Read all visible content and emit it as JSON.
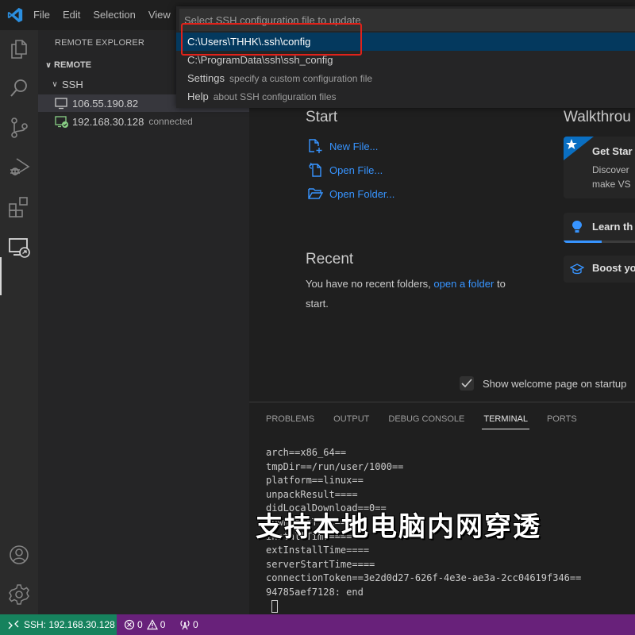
{
  "titlebar": {
    "menu": [
      "File",
      "Edit",
      "Selection",
      "View"
    ]
  },
  "activity_bar": {
    "icons": [
      "explorer-icon",
      "search-icon",
      "source-control-icon",
      "run-debug-icon",
      "extensions-icon",
      "remote-explorer-icon",
      "accounts-icon",
      "settings-gear-icon"
    ],
    "active": "remote-explorer-icon"
  },
  "sidebar": {
    "title": "REMOTE EXPLORER",
    "section": "REMOTE",
    "group": "SSH",
    "hosts": [
      {
        "name": "106.55.190.82",
        "status": "",
        "icon": "monitor-icon"
      },
      {
        "name": "192.168.30.128",
        "status": "connected",
        "icon": "monitor-connected-icon"
      }
    ]
  },
  "quick_pick": {
    "placeholder": "Select SSH configuration file to update",
    "items": [
      {
        "label": "C:\\Users\\THHK\\.ssh\\config",
        "description": "",
        "selected": true
      },
      {
        "label": "C:\\ProgramData\\ssh\\ssh_config",
        "description": ""
      },
      {
        "label": "Settings",
        "description": "specify a custom configuration file"
      },
      {
        "label": "Help",
        "description": "about SSH configuration files"
      }
    ],
    "highlight_color": "#e0221a"
  },
  "welcome": {
    "start_heading": "Start",
    "start_links": [
      {
        "label": "New File...",
        "icon": "new-file-icon"
      },
      {
        "label": "Open File...",
        "icon": "open-file-icon"
      },
      {
        "label": "Open Folder...",
        "icon": "open-folder-icon"
      }
    ],
    "recent_heading": "Recent",
    "recent_text_before": "You have no recent folders,",
    "recent_link": "open a folder",
    "recent_text_after": "to start.",
    "walkthroughs_heading": "Walkthrou",
    "walkthroughs": [
      {
        "title": "Get Star",
        "description": [
          "Discover",
          "make VS"
        ],
        "icon": "star-icon"
      },
      {
        "title": "Learn th",
        "icon": "lightbulb-icon",
        "progress": 0.4
      },
      {
        "title": "Boost yo",
        "icon": "mortarboard-icon"
      }
    ],
    "show_on_startup_label": "Show welcome page on startup",
    "show_on_startup_checked": true
  },
  "panel": {
    "tabs": [
      "PROBLEMS",
      "OUTPUT",
      "DEBUG CONSOLE",
      "TERMINAL",
      "PORTS"
    ],
    "active_tab": "TERMINAL",
    "terminal_lines": [
      "arch==x86_64==",
      "tmpDir==/run/user/1000==",
      "platform==linux==",
      "unpackResult====",
      "didLocalDownload==0==",
      "downloadTime====",
      "installTime====",
      "extInstallTime====",
      "serverStartTime====",
      "connectionToken==3e2d0d27-626f-4e3e-ae3a-2cc04619f346==",
      "94785aef7128: end"
    ]
  },
  "overlay_caption": "支持本地电脑内网穿透",
  "status_bar": {
    "remote": "SSH: 192.168.30.128",
    "errors": "0",
    "warnings": "0",
    "ports": "0",
    "remote_color": "#16825d",
    "bar_color": "#68217a"
  }
}
